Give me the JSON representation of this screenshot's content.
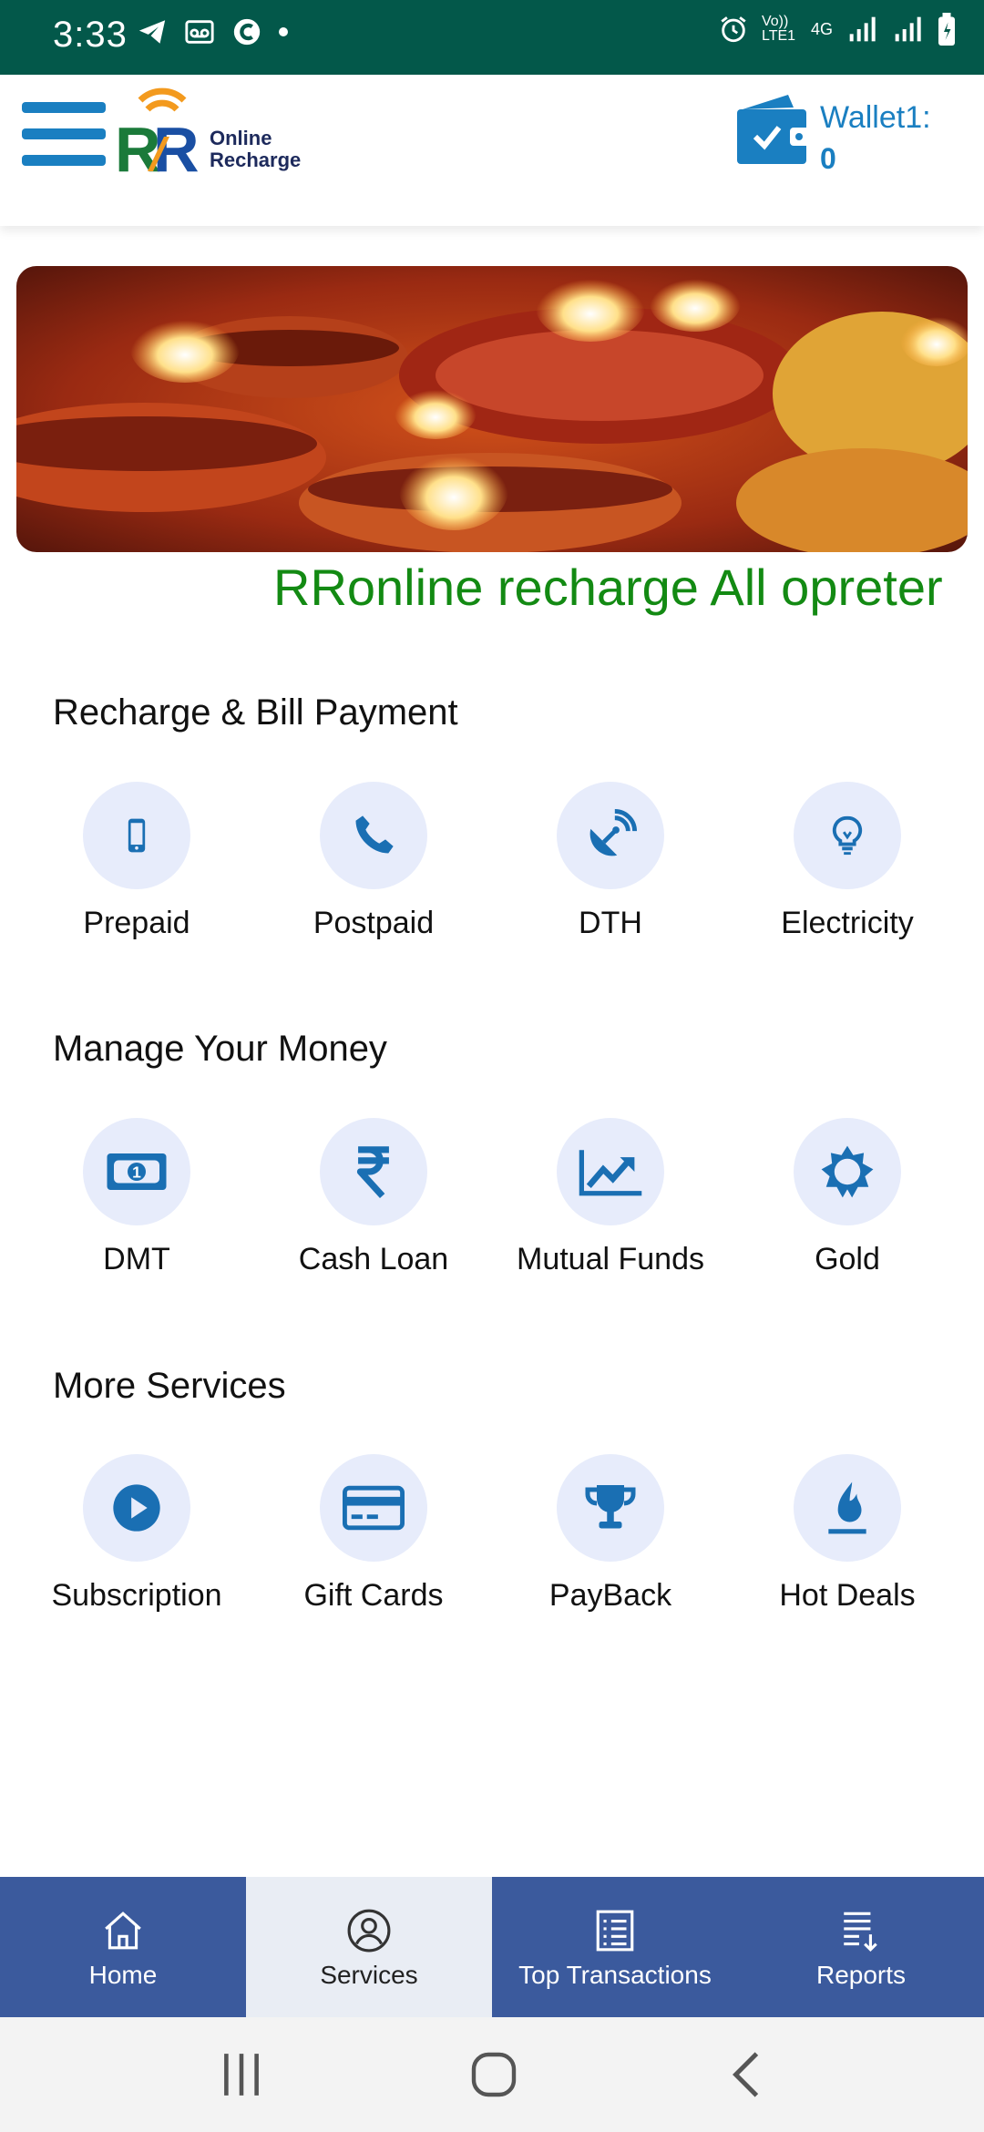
{
  "status_bar": {
    "time": "3:33",
    "network_type": "4G",
    "volte_label": "Vo)) LTE1"
  },
  "header": {
    "logo_line1": "Online",
    "logo_line2": "Recharge",
    "wallet_label": "Wallet1:",
    "wallet_value": "0"
  },
  "marquee": "RRonline recharge All opreter",
  "sections": [
    {
      "title": "Recharge & Bill Payment",
      "items": [
        {
          "label": "Prepaid",
          "icon": "mobile-icon"
        },
        {
          "label": "Postpaid",
          "icon": "phone-icon"
        },
        {
          "label": "DTH",
          "icon": "satellite-dish-icon"
        },
        {
          "label": "Electricity",
          "icon": "lightbulb-icon"
        }
      ]
    },
    {
      "title": "Manage Your Money",
      "items": [
        {
          "label": "DMT",
          "icon": "money-bill-icon"
        },
        {
          "label": "Cash Loan",
          "icon": "rupee-icon"
        },
        {
          "label": "Mutual Funds",
          "icon": "chart-line-icon"
        },
        {
          "label": "Gold",
          "icon": "sun-icon"
        }
      ]
    },
    {
      "title": "More Services",
      "items": [
        {
          "label": "Subscription",
          "icon": "play-circle-icon"
        },
        {
          "label": "Gift Cards",
          "icon": "credit-card-icon"
        },
        {
          "label": "PayBack",
          "icon": "trophy-icon"
        },
        {
          "label": "Hot Deals",
          "icon": "flame-icon"
        }
      ]
    }
  ],
  "bottom_nav": [
    {
      "label": "Home",
      "icon": "home-icon",
      "active": false
    },
    {
      "label": "Services",
      "icon": "user-circle-icon",
      "active": true
    },
    {
      "label": "Top Transactions",
      "icon": "list-icon",
      "active": false
    },
    {
      "label": "Reports",
      "icon": "report-icon",
      "active": false
    }
  ],
  "colors": {
    "status_bar": "#03584a",
    "accent": "#1a7fc1",
    "marquee": "#138a13",
    "bottom_nav": "#3b5a9d",
    "icon_circle": "#e7ecfb"
  }
}
